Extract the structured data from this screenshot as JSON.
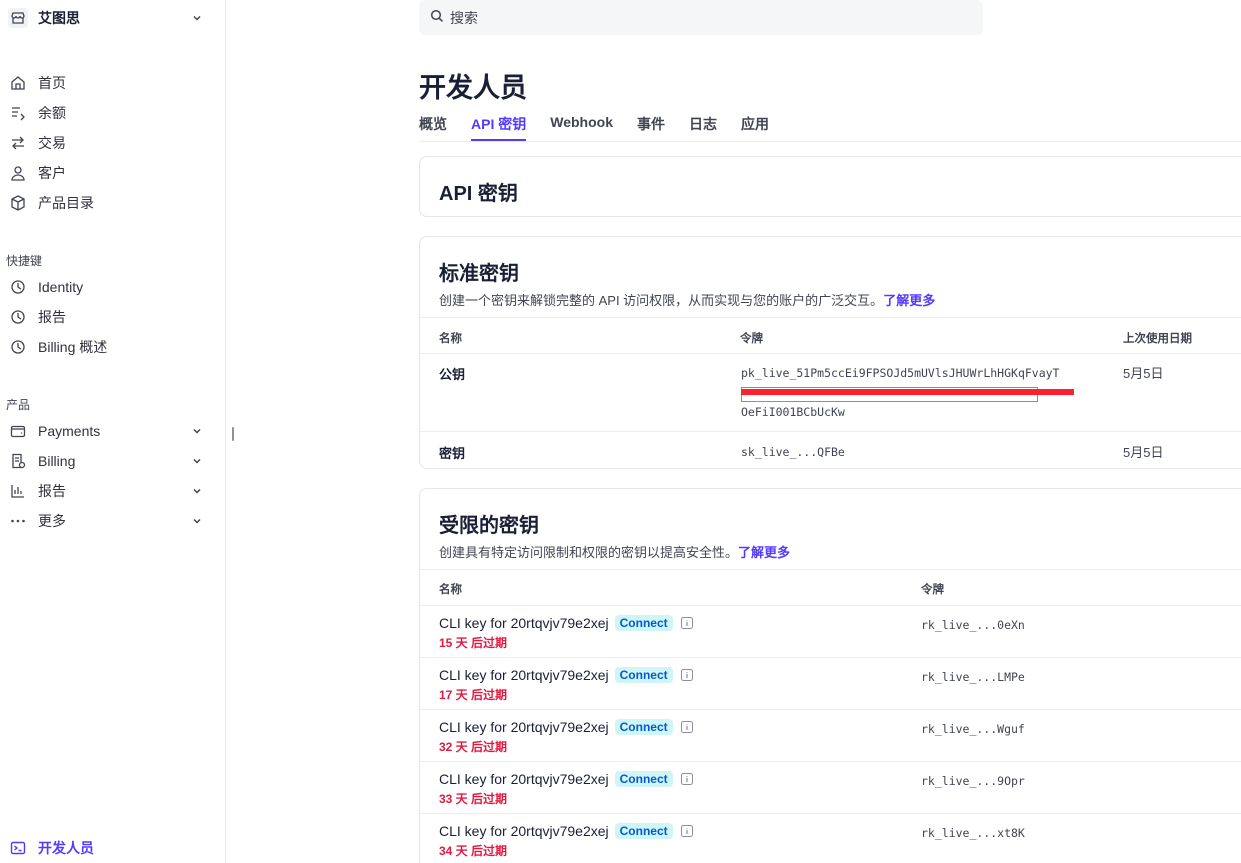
{
  "account": {
    "name": "艾图思"
  },
  "nav": {
    "main": [
      {
        "label": "首页",
        "icon": "home-icon"
      },
      {
        "label": "余额",
        "icon": "balance-icon"
      },
      {
        "label": "交易",
        "icon": "transactions-icon"
      },
      {
        "label": "客户",
        "icon": "customer-icon"
      },
      {
        "label": "产品目录",
        "icon": "product-icon"
      }
    ],
    "shortcuts_title": "快捷键",
    "shortcuts": [
      {
        "label": "Identity",
        "icon": "clock-icon"
      },
      {
        "label": "报告",
        "icon": "clock-icon"
      },
      {
        "label": "Billing 概述",
        "icon": "clock-icon"
      }
    ],
    "products_title": "产品",
    "products": [
      {
        "label": "Payments",
        "icon": "wallet-icon"
      },
      {
        "label": "Billing",
        "icon": "billing-icon"
      },
      {
        "label": "报告",
        "icon": "bar-chart-icon"
      },
      {
        "label": "更多",
        "icon": "more-icon"
      }
    ],
    "developer": {
      "label": "开发人员",
      "icon": "terminal-icon"
    }
  },
  "search": {
    "placeholder": "搜索"
  },
  "page": {
    "title": "开发人员",
    "tabs": [
      "概览",
      "API 密钥",
      "Webhook",
      "事件",
      "日志",
      "应用"
    ],
    "active_tab": "API 密钥"
  },
  "api_header": {
    "title": "API 密钥"
  },
  "standard": {
    "title": "标准密钥",
    "subtitle": "创建一个密钥来解锁完整的 API 访问权限，从而实现与您的账户的广泛交互。",
    "learn_more": "了解更多",
    "headers": {
      "name": "名称",
      "token": "令牌",
      "last_used": "上次使用日期"
    },
    "rows": [
      {
        "name": "公钥",
        "token_line1": "pk_live_51Pm5ccEi9FPSOJd5mUVlsJHUWrLhHGKqFvayT",
        "token_line3": "OeFiI001BCbUcKw",
        "last_used": "5月5日"
      },
      {
        "name": "密钥",
        "token": "sk_live_...QFBe",
        "last_used": "5月5日"
      }
    ]
  },
  "restricted": {
    "title": "受限的密钥",
    "subtitle": "创建具有特定访问限制和权限的密钥以提高安全性。",
    "learn_more": "了解更多",
    "headers": {
      "name": "名称",
      "token": "令牌"
    },
    "badge": "Connect",
    "rows": [
      {
        "name": "CLI key for 20rtqvjv79e2xej",
        "expire": "15 天 后过期",
        "token": "rk_live_...0eXn"
      },
      {
        "name": "CLI key for 20rtqvjv79e2xej",
        "expire": "17 天 后过期",
        "token": "rk_live_...LMPe"
      },
      {
        "name": "CLI key for 20rtqvjv79e2xej",
        "expire": "32 天 后过期",
        "token": "rk_live_...Wguf"
      },
      {
        "name": "CLI key for 20rtqvjv79e2xej",
        "expire": "33 天 后过期",
        "token": "rk_live_...9Opr"
      },
      {
        "name": "CLI key for 20rtqvjv79e2xej",
        "expire": "34 天 后过期",
        "token": "rk_live_...xt8K"
      }
    ]
  },
  "colors": {
    "accent": "#533afd",
    "danger": "#df1b41",
    "badge_bg": "#cff5f6",
    "redaction": "#ff1f2d"
  }
}
